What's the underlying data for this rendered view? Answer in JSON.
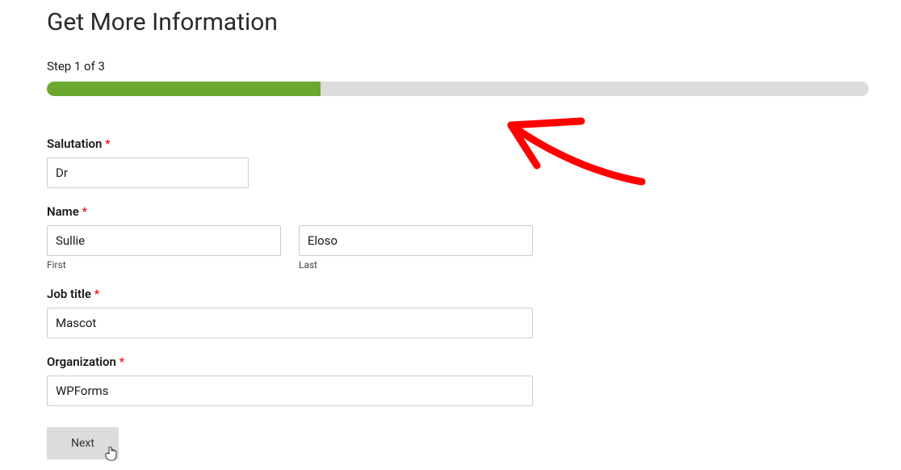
{
  "form": {
    "title": "Get More Information",
    "step_label": "Step 1 of 3",
    "progress_percent": 33.33,
    "fields": {
      "salutation": {
        "label": "Salutation",
        "value": "Dr",
        "required": true
      },
      "name": {
        "label": "Name",
        "required": true,
        "first": {
          "value": "Sullie",
          "sublabel": "First"
        },
        "last": {
          "value": "Eloso",
          "sublabel": "Last"
        }
      },
      "job_title": {
        "label": "Job title",
        "value": "Mascot",
        "required": true
      },
      "organization": {
        "label": "Organization",
        "value": "WPForms",
        "required": true
      }
    },
    "next_button": "Next",
    "required_marker": "*"
  },
  "annotation": {
    "arrow_color": "#ff0000"
  }
}
